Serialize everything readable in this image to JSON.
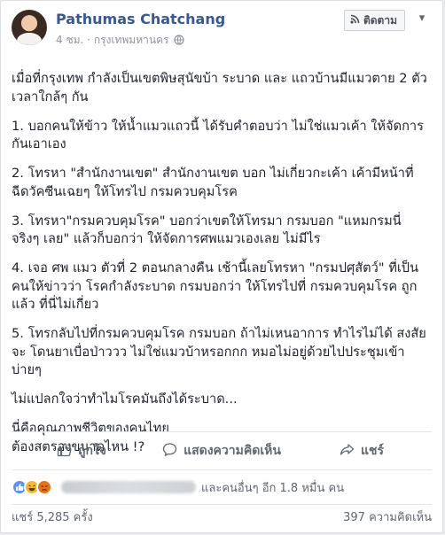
{
  "post": {
    "author": "Pathumas Chatchang",
    "time": "4 ชม.",
    "separator": "·",
    "location": "กรุงเทพมหานคร",
    "follow_label": "ติดตาม",
    "more_label": "▾",
    "paragraphs": [
      "เมื่อที่กรุงเทพ กำลังเป็นเขตพิษสุนัขบ้า ระบาด และ แถวบ้านมีแมวตาย 2 ตัว เวลาใกล้ๆ กัน",
      "1. บอกคนให้ข้าว ให้น้ำแมวแถวนี้ ได้รับคำตอบว่า ไม่ใช่แมวเค้า ให้จัดการกันเอาเอง",
      "2. โทรหา \"สำนักงานเขต\" สำนักงานเขต บอก ไม่เกี่ยวกะเค้า เค้ามีหน้าที่ฉีดวัคซีนเฉยๆ ให้โทรไป กรมควบคุมโรค",
      "3. โทรหา\"กรมควบคุมโรค\" บอกว่าเขตให้โทรมา กรมบอก \"แหมกรมนี่จริงๆ เลย\" แล้วก็บอกว่า ให้จัดการศพแมวเองเลย ไม่มีไร",
      "4. เจอ ศพ แมว ตัวที่ 2 ตอนกลางคืน เช้านี้เลยโทรหา \"กรมปศุสัตว์\" ที่เป็นคนให้ข่าวว่า โรคกำลังระบาด กรมบอกว่า ให้โทรไปที่ กรมควบคุมโรค ถูกแล้ว ที่นี่ไม่เกี่ยว",
      "5. โทรกลับไปที่กรมควบคุมโรค กรมบอก ถ้าไม่เหนอาการ ทำไรไม่ได้ สงสัยจะ โดนยาเบื่อป่าววว ไม่ใช่แมวบ้าหรอกกก หมอไม่อยู่ด้วยไปประชุมเข้าบ่ายๆ",
      "ไม่แปลกใจว่าทำไมโรคมันถึงได้ระบาด...",
      "นี่คือคุณภาพชีวิตของคนไทย\nต้องสตรองขนาดไหน !?"
    ]
  },
  "actions": {
    "like": "ถูกใจ",
    "comment": "แสดงความคิดเห็น",
    "share": "แชร์"
  },
  "reactions": {
    "others_text": "และคนอื่นๆ อีก 1.8 หมื่น คน",
    "colors": {
      "like": "#5890ff",
      "haha": "#f7b928",
      "angry": "#e9710f"
    }
  },
  "stats": {
    "shares": "แชร์ 5,285 ครั้ง",
    "comments": "397 ความคิดเห็น"
  }
}
